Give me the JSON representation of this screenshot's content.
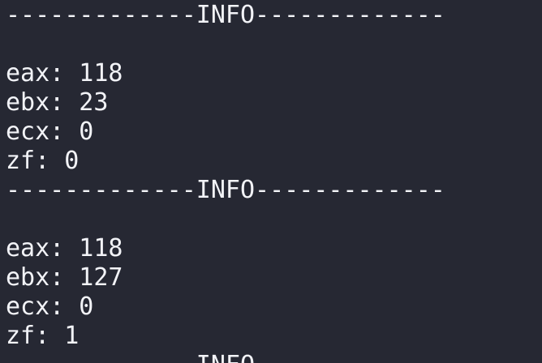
{
  "terminal": {
    "separator": "-------------INFO-------------",
    "blocks": [
      {
        "eax": "eax: 118",
        "ebx": "ebx: 23",
        "ecx": "ecx: 0",
        "zf": "zf: 0"
      },
      {
        "eax": "eax: 118",
        "ebx": "ebx: 127",
        "ecx": "ecx: 0",
        "zf": "zf: 1"
      }
    ]
  },
  "colors": {
    "background": "#262833",
    "text": "#f2f3f7"
  }
}
